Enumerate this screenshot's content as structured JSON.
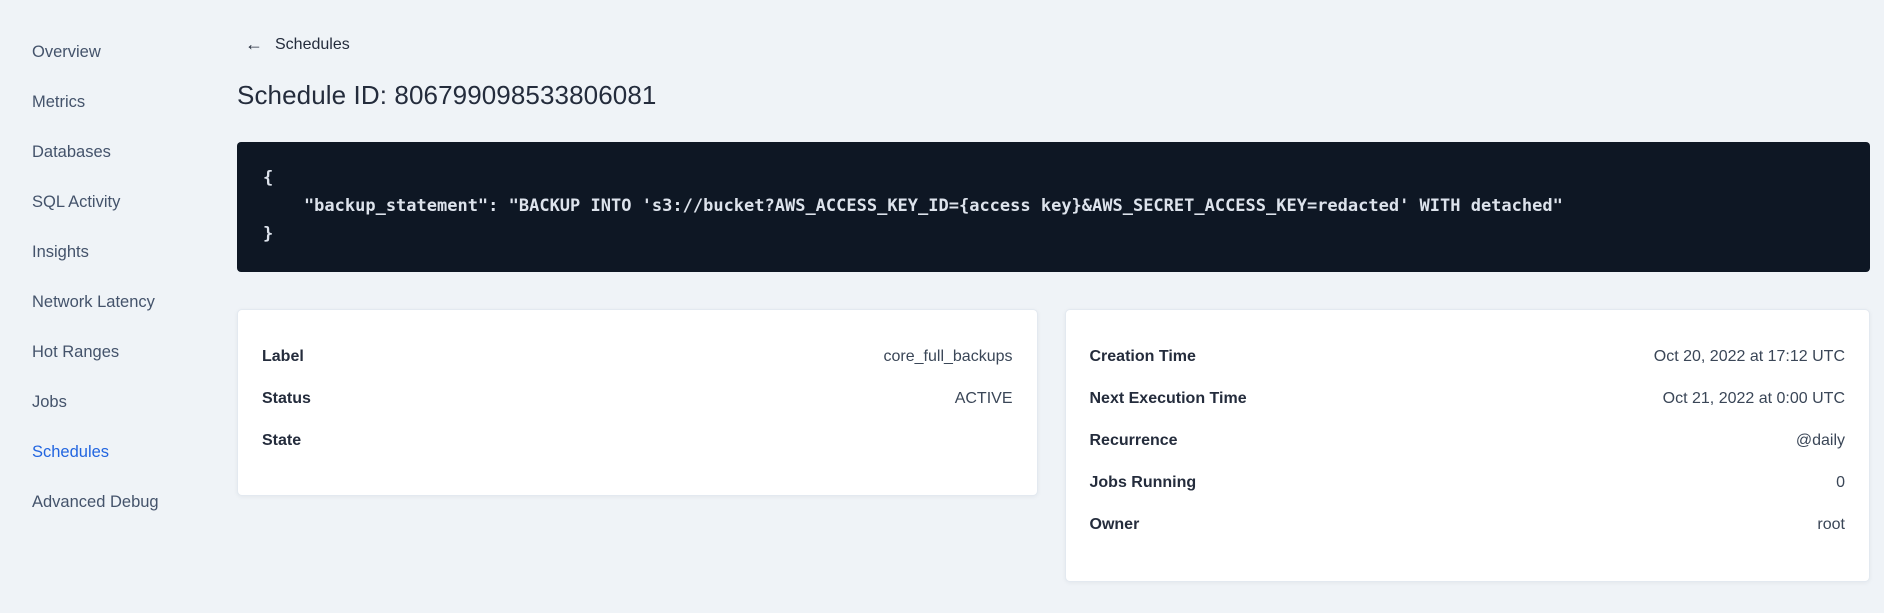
{
  "sidebar": {
    "items": [
      {
        "label": "Overview"
      },
      {
        "label": "Metrics"
      },
      {
        "label": "Databases"
      },
      {
        "label": "SQL Activity"
      },
      {
        "label": "Insights"
      },
      {
        "label": "Network Latency"
      },
      {
        "label": "Hot Ranges"
      },
      {
        "label": "Jobs"
      },
      {
        "label": "Schedules",
        "active": true
      },
      {
        "label": "Advanced Debug"
      }
    ],
    "active_color": "#2265e0"
  },
  "header": {
    "back_icon_glyph": "←",
    "back_label": "Schedules",
    "title": "Schedule ID: 806799098533806081"
  },
  "code_block": {
    "background": "#0e1724",
    "lines": [
      "{",
      "    \"backup_statement\": \"BACKUP INTO 's3://bucket?AWS_ACCESS_KEY_ID={access key}&AWS_SECRET_ACCESS_KEY=redacted' WITH detached\"",
      "}"
    ]
  },
  "details_left": {
    "rows": [
      {
        "label": "Label",
        "value": "core_full_backups"
      },
      {
        "label": "Status",
        "value": "ACTIVE"
      },
      {
        "label": "State",
        "value": ""
      }
    ]
  },
  "details_right": {
    "rows": [
      {
        "label": "Creation Time",
        "value": "Oct 20, 2022 at 17:12 UTC"
      },
      {
        "label": "Next Execution Time",
        "value": "Oct 21, 2022 at 0:00 UTC"
      },
      {
        "label": "Recurrence",
        "value": "@daily"
      },
      {
        "label": "Jobs Running",
        "value": "0"
      },
      {
        "label": "Owner",
        "value": "root"
      }
    ]
  }
}
